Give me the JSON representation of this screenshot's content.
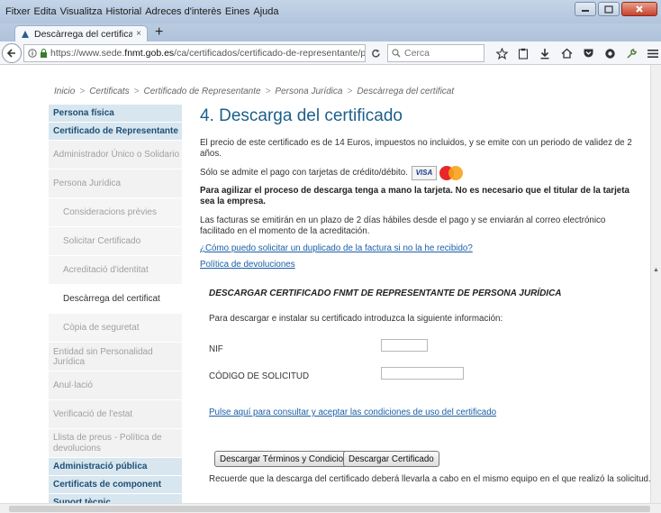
{
  "menu": [
    "Fitxer",
    "Edita",
    "Visualitza",
    "Historial",
    "Adreces d'interès",
    "Eines",
    "Ajuda"
  ],
  "tab": {
    "label": "Descàrrega del certificat - Se",
    "close": "×"
  },
  "new_tab": "+",
  "url": {
    "prefix": "https://www.sede.",
    "domain": "fnmt.gob.es",
    "path": "/ca/certificados/certificado-de-representante/p"
  },
  "search": {
    "placeholder": "Cerca"
  },
  "breadcrumb": [
    "Inicio",
    "Certificats",
    "Certificado de Representante",
    "Persona Jurídica",
    "Descàrrega del certificat"
  ],
  "breadcrumb_sep": ">",
  "sidebar": [
    {
      "label": "Persona física",
      "kind": "head"
    },
    {
      "label": "Certificado de Representante",
      "kind": "head"
    },
    {
      "label": "Administrador Único o Solidario",
      "kind": "item"
    },
    {
      "label": "Persona Jurídica",
      "kind": "tall"
    },
    {
      "label": "Consideracions prèvies",
      "kind": "sub"
    },
    {
      "label": "Solicitar Certificado",
      "kind": "sub"
    },
    {
      "label": "Acreditació d'identitat",
      "kind": "sub"
    },
    {
      "label": "Descàrrega del certificat",
      "kind": "sub-active"
    },
    {
      "label": "Còpia de seguretat",
      "kind": "sub"
    },
    {
      "label": "Entidad sin Personalidad Jurídica",
      "kind": "tall"
    },
    {
      "label": "Anul·lació",
      "kind": "tall"
    },
    {
      "label": "Verificació de l'estat",
      "kind": "tall"
    },
    {
      "label": "Llista de preus - Política de devolucions",
      "kind": "multi"
    },
    {
      "label": "Administració pública",
      "kind": "head"
    },
    {
      "label": "Certificats de component",
      "kind": "head"
    },
    {
      "label": "Suport tècnic",
      "kind": "head"
    }
  ],
  "content": {
    "title": "4. Descarga del certificado",
    "price": "El precio de este certificado es de 14 Euros, impuestos no incluidos, y se emite con un periodo de validez de 2 años.",
    "payment": "Sólo se admite el pago con tarjetas de crédito/débito.",
    "visa": "VISA",
    "mastercard": "MasterCard",
    "agilizar": "Para agilizar el proceso de descarga tenga a mano la tarjeta. No es necesario que el titular de la tarjeta sea la empresa.",
    "facturas": "Las facturas se emitirán en un plazo de 2 días hábiles desde el pago y se enviarán al correo electrónico facilitado en el momento de la acreditación.",
    "link_duplicado": "¿Cómo puedo solicitar un duplicado de la factura si no la he recibido?",
    "link_devoluciones": "Política de devoluciones"
  },
  "form": {
    "title": "DESCARGAR CERTIFICADO FNMT DE REPRESENTANTE DE PERSONA JURÍDICA",
    "intro": "Para descargar e instalar su certificado introduzca la siguiente información:",
    "nif_label": "NIF",
    "nif_value": "",
    "codigo_label": "CÓDIGO DE SOLICITUD",
    "codigo_value": "",
    "conditions_link": "Pulse aquí para consultar y aceptar las condiciones de uso del certificado",
    "btn_terms": "Descargar Términos y Condiciones",
    "btn_download": "Descargar Certificado",
    "note": "Recuerde que la descarga del certificado deberá llevarla a cabo en el mismo equipo en el que realizó la solicitud."
  },
  "colors": {
    "title_blue": "#1c5f8a",
    "link_blue": "#1a5ea6",
    "sidebar_head_bg": "#d8e6f0",
    "sidebar_head_fg": "#1f4f74"
  }
}
